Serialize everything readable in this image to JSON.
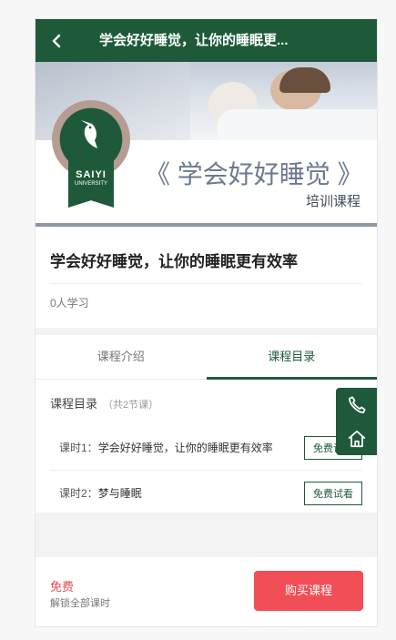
{
  "header": {
    "title": "学会好好睡觉，让你的睡眠更..."
  },
  "banner": {
    "logo": {
      "name": "SAIYI",
      "sub": "UNIVERSITY"
    },
    "title": "《 学会好好睡觉 》",
    "subtitle": "培训课程"
  },
  "course": {
    "title": "学会好好睡觉，让你的睡眠更有效率",
    "learners": "0人学习"
  },
  "tabs": [
    {
      "label": "课程介绍",
      "active": false
    },
    {
      "label": "课程目录",
      "active": true
    }
  ],
  "catalog": {
    "heading": "课程目录",
    "count": "（共2节课）",
    "lessons": [
      {
        "index": "课时1：",
        "title": "学会好好睡觉，让你的睡眠更有效率",
        "button": "免费试看"
      },
      {
        "index": "课时2：",
        "title": "梦与睡眠",
        "button": "免费试看"
      }
    ]
  },
  "footer": {
    "price": "免费",
    "note": "解锁全部课时",
    "buy_label": "购买课程"
  },
  "colors": {
    "primary": "#1e5a3a",
    "accent": "#f14e57",
    "price": "#e9484f"
  },
  "icons": {
    "back": "chevron-left-icon",
    "phone": "phone-icon",
    "home": "home-icon"
  }
}
